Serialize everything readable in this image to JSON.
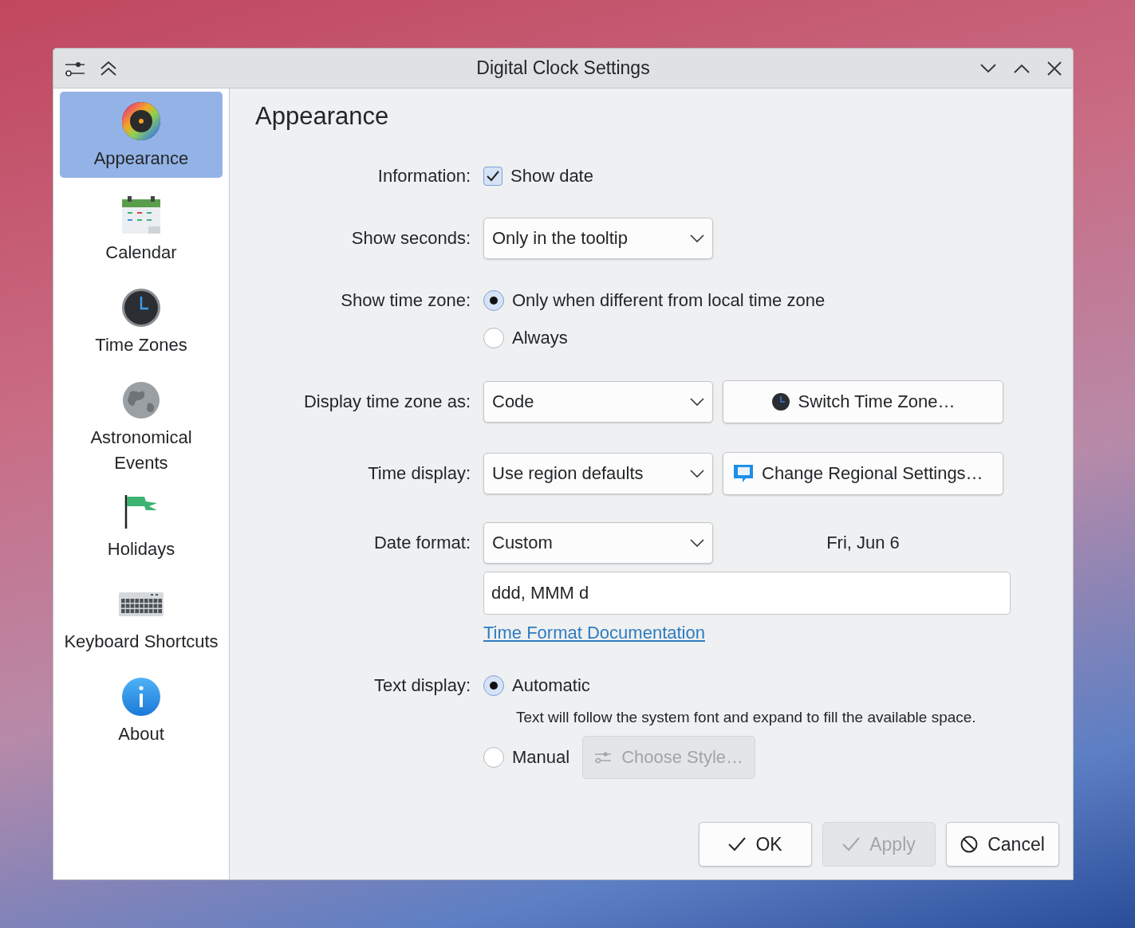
{
  "window": {
    "title": "Digital Clock Settings"
  },
  "sidebar": {
    "items": [
      {
        "label": "Appearance",
        "selected": true
      },
      {
        "label": "Calendar",
        "selected": false
      },
      {
        "label": "Time Zones",
        "selected": false
      },
      {
        "label": "Astronomical Events",
        "selected": false
      },
      {
        "label": "Holidays",
        "selected": false
      },
      {
        "label": "Keyboard Shortcuts",
        "selected": false
      },
      {
        "label": "About",
        "selected": false
      }
    ]
  },
  "page_title": "Appearance",
  "information": {
    "label": "Information:",
    "checkbox": {
      "label": "Show date",
      "checked": true
    }
  },
  "show_seconds": {
    "label": "Show seconds:",
    "value": "Only in the tooltip"
  },
  "show_time_zone": {
    "label": "Show time zone:",
    "options": [
      {
        "label": "Only when different from local time zone",
        "selected": true
      },
      {
        "label": "Always",
        "selected": false
      }
    ]
  },
  "display_time_zone_as": {
    "label": "Display time zone as:",
    "value": "Code",
    "button": "Switch Time Zone…"
  },
  "time_display": {
    "label": "Time display:",
    "value": "Use region defaults",
    "button": "Change Regional Settings…"
  },
  "date_format": {
    "label": "Date format:",
    "value": "Custom",
    "preview": "Fri, Jun 6",
    "pattern": "ddd, MMM d",
    "link": "Time Format Documentation"
  },
  "text_display": {
    "label": "Text display:",
    "options": [
      {
        "label": "Automatic",
        "selected": true,
        "hint": "Text will follow the system font and expand to fill the available space."
      },
      {
        "label": "Manual",
        "selected": false
      }
    ],
    "choose_style": {
      "label": "Choose Style…",
      "disabled": true
    }
  },
  "buttons": [
    {
      "kind": "ok",
      "label": "OK",
      "disabled": false
    },
    {
      "kind": "apply",
      "label": "Apply",
      "disabled": true
    },
    {
      "kind": "cancel",
      "label": "Cancel",
      "disabled": false
    }
  ]
}
